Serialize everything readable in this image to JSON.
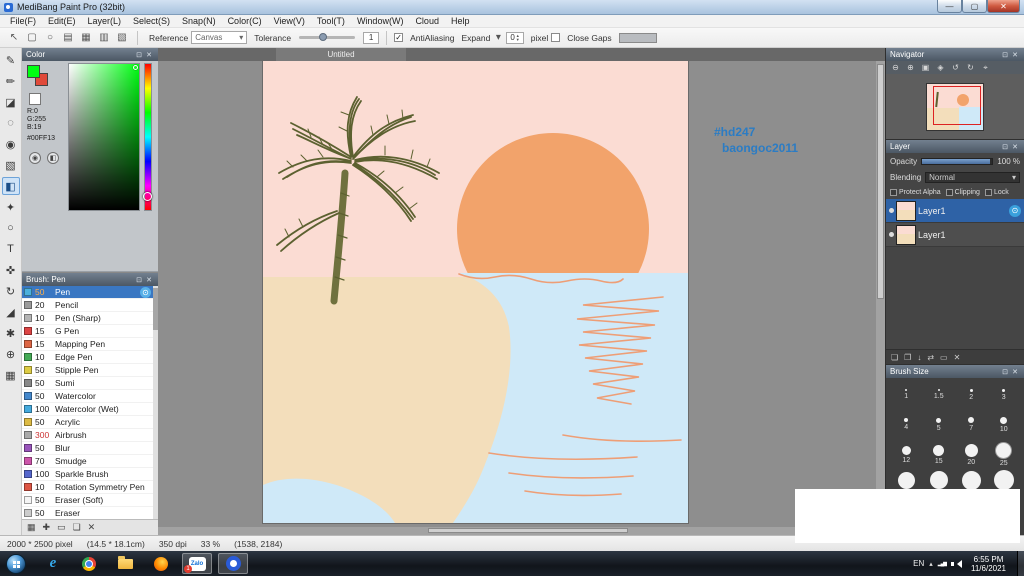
{
  "window": {
    "title": "MediBang Paint Pro (32bit)",
    "minimize_glyph": "—",
    "maximize_glyph": "▢",
    "close_glyph": "✕"
  },
  "panel": {
    "dock_glyph": "⊡",
    "close_glyph": "✕"
  },
  "menubar": {
    "items": [
      "File(F)",
      "Edit(E)",
      "Layer(L)",
      "Select(S)",
      "Snap(N)",
      "Color(C)",
      "View(V)",
      "Tool(T)",
      "Window(W)",
      "Cloud",
      "Help"
    ]
  },
  "toolbar": {
    "icons": [
      {
        "name": "cursor-icon",
        "glyph": "↖"
      },
      {
        "name": "marquee-icon",
        "glyph": "▢"
      },
      {
        "name": "balloon-icon",
        "glyph": "○"
      },
      {
        "name": "script-icon",
        "glyph": "▤"
      },
      {
        "name": "panel-grid-icon",
        "glyph": "▦"
      },
      {
        "name": "panel-split-icon",
        "glyph": "▥"
      },
      {
        "name": "panel-diagonal-icon",
        "glyph": "▧"
      }
    ],
    "reference_label": "Reference",
    "reference_value": "Canvas",
    "tolerance_label": "Tolerance",
    "tolerance_value": "1",
    "antialiasing_label": "AntiAliasing",
    "antialiasing_check": "✓",
    "expand_label": "Expand",
    "expand_value": "0",
    "expand_unit": "pixel",
    "close_gaps_label": "Close Gaps"
  },
  "left_tools": {
    "tools": [
      {
        "name": "pen-tool-icon",
        "glyph": "✎"
      },
      {
        "name": "pencil-tool-icon",
        "glyph": "✏"
      },
      {
        "name": "eraser-tool-icon",
        "glyph": "◪"
      },
      {
        "name": "airbrush-tool-icon",
        "glyph": "◌"
      },
      {
        "name": "dot-pen-tool-icon",
        "glyph": "◉"
      },
      {
        "name": "gradient-tool-icon",
        "glyph": "▧"
      },
      {
        "name": "bucket-tool-icon",
        "glyph": "◧",
        "active": true
      },
      {
        "name": "magic-wand-tool-icon",
        "glyph": "✦"
      },
      {
        "name": "lasso-tool-icon",
        "glyph": "○"
      },
      {
        "name": "text-tool-icon",
        "glyph": "T"
      },
      {
        "name": "move-tool-icon",
        "glyph": "✜"
      },
      {
        "name": "rotate-tool-icon",
        "glyph": "↻"
      },
      {
        "name": "eyedropper-tool-icon",
        "glyph": "◢"
      },
      {
        "name": "hand-tool-icon",
        "glyph": "✱"
      },
      {
        "name": "zoom-tool-icon",
        "glyph": "⊕"
      },
      {
        "name": "divide-tool-icon",
        "glyph": "▦"
      }
    ]
  },
  "color_panel": {
    "title": "Color",
    "r_label": "R:0",
    "g_label": "G:255",
    "b_label": "B:19",
    "hex": "#00FF13",
    "foreground_color": "#00FF13",
    "background_color": "#e04a3a",
    "picker_buttons": [
      {
        "name": "eyedropper-icon",
        "glyph": "◉"
      },
      {
        "name": "screen-color-icon",
        "glyph": "◧"
      }
    ]
  },
  "brush_panel": {
    "title": "Brush: Pen",
    "gear_glyph": "⊙",
    "brushes": [
      {
        "size": "50",
        "name": "Pen",
        "swatch": "#4cb0dc",
        "selected": true,
        "size_color": "#ffb04a"
      },
      {
        "size": "20",
        "name": "Pencil",
        "swatch": "#9a9a9a"
      },
      {
        "size": "10",
        "name": "Pen (Sharp)",
        "swatch": "#b4b4b4"
      },
      {
        "size": "15",
        "name": "G Pen",
        "swatch": "#dd4444"
      },
      {
        "size": "15",
        "name": "Mapping Pen",
        "swatch": "#dd6644"
      },
      {
        "size": "10",
        "name": "Edge Pen",
        "swatch": "#44aa55"
      },
      {
        "size": "50",
        "name": "Stipple Pen",
        "swatch": "#ddcc44"
      },
      {
        "size": "50",
        "name": "Sumi",
        "swatch": "#888888"
      },
      {
        "size": "50",
        "name": "Watercolor",
        "swatch": "#4488cc"
      },
      {
        "size": "100",
        "name": "Watercolor (Wet)",
        "swatch": "#44aadd"
      },
      {
        "size": "50",
        "name": "Acrylic",
        "swatch": "#ddbb44"
      },
      {
        "size": "300",
        "name": "Airbrush",
        "swatch": "#aaaaaa",
        "size_color": "#cc3333"
      },
      {
        "size": "50",
        "name": "Blur",
        "swatch": "#9955bb"
      },
      {
        "size": "70",
        "name": "Smudge",
        "swatch": "#cc55aa"
      },
      {
        "size": "100",
        "name": "Sparkle Brush",
        "swatch": "#5566cc"
      },
      {
        "size": "10",
        "name": "Rotation Symmetry Pen",
        "swatch": "#dd5544"
      },
      {
        "size": "50",
        "name": "Eraser (Soft)",
        "swatch": "#f5f5f5"
      },
      {
        "size": "50",
        "name": "Eraser",
        "swatch": "#cccccc"
      }
    ],
    "footer_icons": [
      {
        "name": "grid-view-icon",
        "glyph": "▦"
      },
      {
        "name": "add-brush-icon",
        "glyph": "✚"
      },
      {
        "name": "brush-folder-icon",
        "glyph": "▭"
      },
      {
        "name": "duplicate-brush-icon",
        "glyph": "❏"
      },
      {
        "name": "delete-brush-icon",
        "glyph": "✕"
      }
    ]
  },
  "canvas": {
    "tab": "Untitled",
    "watermark1": "#hd247",
    "watermark2": "baongoc2011",
    "colors": {
      "sky": "#fbdcd3",
      "sun": "#f2a36b",
      "sand": "#f3debb",
      "water": "#cfe9f8",
      "palm": "#5c6130",
      "trunk": "#6f713e",
      "reflection": "#ee9e76",
      "watermark": "#2b7cc4"
    }
  },
  "navigator": {
    "title": "Navigator",
    "view_rect_color": "#dd2222",
    "icons": [
      {
        "name": "zoom-out-icon",
        "glyph": "⊖"
      },
      {
        "name": "zoom-in-icon",
        "glyph": "⊕"
      },
      {
        "name": "zoom-fit-icon",
        "glyph": "▣"
      },
      {
        "name": "zoom-100-icon",
        "glyph": "◈"
      },
      {
        "name": "rotate-left-icon",
        "glyph": "↺"
      },
      {
        "name": "rotate-right-icon",
        "glyph": "↻"
      },
      {
        "name": "reset-view-icon",
        "glyph": "⌖"
      }
    ]
  },
  "layer_panel": {
    "title": "Layer",
    "opacity_label": "Opacity",
    "opacity_value": "100 %",
    "blending_label": "Blending",
    "blending_value": "Normal",
    "checkboxes": [
      {
        "label": "Protect Alpha"
      },
      {
        "label": "Clipping"
      },
      {
        "label": "Lock"
      }
    ],
    "layers": [
      {
        "name": "Layer1",
        "selected": true
      },
      {
        "name": "Layer1"
      }
    ],
    "footer_icons": [
      {
        "name": "new-layer-icon",
        "glyph": "❏"
      },
      {
        "name": "duplicate-layer-icon",
        "glyph": "❐"
      },
      {
        "name": "merge-down-icon",
        "glyph": "↓"
      },
      {
        "name": "transfer-icon",
        "glyph": "⇄"
      },
      {
        "name": "layer-folder-icon",
        "glyph": "▭"
      },
      {
        "name": "delete-layer-icon",
        "glyph": "✕"
      }
    ]
  },
  "brush_size_panel": {
    "title": "Brush Size",
    "sizes": [
      {
        "label": "1",
        "dot": "2px"
      },
      {
        "label": "1.5",
        "dot": "2px"
      },
      {
        "label": "2",
        "dot": "3px"
      },
      {
        "label": "3",
        "dot": "3px"
      },
      {
        "label": "4",
        "dot": "4px"
      },
      {
        "label": "5",
        "dot": "5px"
      },
      {
        "label": "7",
        "dot": "6px"
      },
      {
        "label": "10",
        "dot": "7px"
      },
      {
        "label": "12",
        "dot": "9px"
      },
      {
        "label": "15",
        "dot": "11px"
      },
      {
        "label": "20",
        "dot": "13px"
      },
      {
        "label": "25",
        "dot": "15px",
        "selected": true
      },
      {
        "label": "",
        "dot": "17px"
      },
      {
        "label": "",
        "dot": "18px"
      },
      {
        "label": "",
        "dot": "19px"
      },
      {
        "label": "",
        "dot": "20px"
      }
    ]
  },
  "statusbar": {
    "dimensions": "2000 * 2500 pixel",
    "size_cm": "(14.5 * 18.1cm)",
    "dpi": "350 dpi",
    "zoom": "33 %",
    "coords": "(1538, 2184)"
  },
  "taskbar": {
    "items": [
      {
        "name": "internet-explorer-icon",
        "cls": "icon-ie",
        "label": "e"
      },
      {
        "name": "chrome-icon",
        "cls": "icon-chrome"
      },
      {
        "name": "file-explorer-icon",
        "cls": "icon-folder"
      },
      {
        "name": "firefox-icon",
        "cls": "icon-firefox"
      },
      {
        "name": "zalo-icon",
        "cls": "icon-zalo",
        "label": "Zalo",
        "badge": "1",
        "active": true
      },
      {
        "name": "medibang-icon",
        "cls": "icon-medibang",
        "active": true
      }
    ],
    "tray": {
      "language": "EN",
      "caret": "▴",
      "net": "▂▄▆",
      "time": "6:55 PM",
      "date": "11/6/2021"
    }
  }
}
